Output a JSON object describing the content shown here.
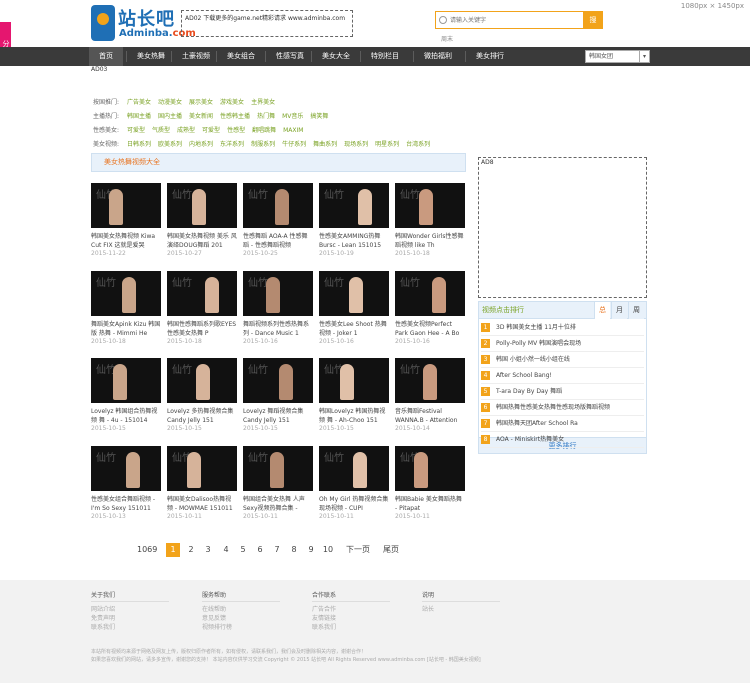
{
  "resolution": "1080px × 1450px",
  "share_label": "分享",
  "logo": {
    "cn": "站长吧",
    "en_main": "Adminba.",
    "en_tail": "com"
  },
  "ad02": "AD02 下载更多的game.net精彩请求 www.adminba.com",
  "search": {
    "placeholder": "请输入关键字",
    "button": "搜",
    "hot": "周末"
  },
  "nav": {
    "items": [
      "首页",
      "美女热舞",
      "土豪视频",
      "美女组合",
      "性感写真",
      "美女大全",
      "特别栏目",
      "微拍福利",
      "美女排行"
    ],
    "active": 0,
    "select_value": "韩国女团"
  },
  "ad03": "AD03",
  "categories": [
    {
      "label": "按国推门:",
      "links": [
        "广告美女",
        "动漫美女",
        "展示美女",
        "游戏美女",
        "主界美女"
      ]
    },
    {
      "label": "主播热门:",
      "links": [
        "韩国主播",
        "国内主播",
        "美女新闻",
        "性感韩主播",
        "热门舞",
        "MV音乐",
        "搞笑舞"
      ]
    },
    {
      "label": "性感美女:",
      "links": [
        "可爱型",
        "气质型",
        "成熟型",
        "可爱型",
        "性感型",
        "翻唱跳舞",
        "MAXIM"
      ]
    },
    {
      "label": "美女视频:",
      "links": [
        "日韩系列",
        "欧美系列",
        "内地系列",
        "东洋系列",
        "制服系列",
        "牛仔系列",
        "舞曲系列",
        "现场系列",
        "明星系列",
        "台湾系列"
      ]
    }
  ],
  "section_title": "美女热舞视频大全",
  "videos": [
    {
      "title": "韩国美女热舞视频 Kiwa Cut FIX 这就是爱哭",
      "date": "2015-11-22"
    },
    {
      "title": "韩国美女热舞视频 美乐 风演绎DOUG舞蹈 201",
      "date": "2015-10-27"
    },
    {
      "title": "性感舞蹈 AOA-A 性感舞蹈 - 性感舞蹈视频",
      "date": "2015-10-25"
    },
    {
      "title": "性感美女AMMING热舞 Bursc - Lean 151015",
      "date": "2015-10-19"
    },
    {
      "title": "韩国Wonder Girls性感舞蹈视频 like Th",
      "date": "2015-10-18"
    },
    {
      "title": "舞蹈美女Apink Kizu 韩国版 热舞 - Mimmi He",
      "date": "2015-10-18"
    },
    {
      "title": "韩国性感舞蹈系列歌EYES 性感美女热舞 P",
      "date": "2015-10-18"
    },
    {
      "title": "舞蹈视频系列性感热舞系列 - Dance Music 1",
      "date": "2015-10-16"
    },
    {
      "title": "性感美女Lee Shoot 热舞视频 - Joker 1",
      "date": "2015-10-16"
    },
    {
      "title": "性感美女视频Perfect Park Gaon Hee - A Bo",
      "date": "2015-10-16"
    },
    {
      "title": "Lovelyz 韩国组合热舞视频 舞 - 4u - 151014",
      "date": "2015-10-15"
    },
    {
      "title": "Lovelyz 多热舞视频合集 Candy Jelly 151",
      "date": "2015-10-15"
    },
    {
      "title": "Lovelyz 舞蹈视频合集 Candy Jelly 151",
      "date": "2015-10-15"
    },
    {
      "title": "韩国Lovelyz 韩国热舞视频 舞 - Ah-Choo 151",
      "date": "2015-10-15"
    },
    {
      "title": "音乐舞蹈Festival WANNA.B - Attention 151",
      "date": "2015-10-14"
    },
    {
      "title": "性感美女组合舞蹈视频 - I'm So Sexy 151011",
      "date": "2015-10-13"
    },
    {
      "title": "韩国美女Dalisoo热舞视频 - MOWMAE 151011",
      "date": "2015-10-11"
    },
    {
      "title": "韩国组合美女热舞 人声 Sexy视频热舞合集 -",
      "date": "2015-10-11"
    },
    {
      "title": "Oh My Girl 热舞视频合集 现场视频 - CUPI",
      "date": "2015-10-11"
    },
    {
      "title": "韩国Babie 美女舞蹈热舞 - Pitapat",
      "date": "2015-10-11"
    }
  ],
  "pager": {
    "total": "1069",
    "pages": [
      "1",
      "2",
      "3",
      "4",
      "5",
      "6",
      "7",
      "8",
      "9",
      "10"
    ],
    "current": 0,
    "next": "下一页",
    "last": "尾页"
  },
  "ad08": "AD8",
  "ranking": {
    "title": "视频点击排行",
    "tabs": [
      "总",
      "月",
      "周"
    ],
    "active_tab": 0,
    "items": [
      "3D 韩国美女主播 11月十位排",
      "Polly-Polly MV 韩国演唱会现场",
      "韩国 小姐小然一线小组在线",
      "After School Bang!",
      "T-ara Day By Day 舞蹈",
      "韩国热舞性感美女热舞性感现场版舞蹈视频",
      "韩国热舞天团After School Ra",
      "AOA - Miniskirt热舞美女"
    ],
    "more": "更多排行"
  },
  "footer": {
    "columns": [
      {
        "title": "关于我们",
        "links": [
          "网站介绍",
          "免责声明",
          "联系我们"
        ]
      },
      {
        "title": "服务帮助",
        "links": [
          "在线帮助",
          "意见反馈",
          "视频排行榜"
        ]
      },
      {
        "title": "合作联系",
        "links": [
          "广告合作",
          "友情链接",
          "联系我们"
        ]
      },
      {
        "title": "说明",
        "links": [
          "站长"
        ]
      }
    ],
    "note1": "本站所有视频均来源于网络及网友上传，版权归原作者所有，如有侵权，请联系我们，我们会及时删除相关内容，谢谢合作！",
    "note2": "如果您喜欢我们的网站，请多多宣传，谢谢您的支持！ 本站内容仅供学习交流  Copyright © 2015 站长吧 All Rights Reserved  www.adminba.com  [站长吧 - 韩国美女视频]"
  },
  "colors": {
    "nav_bg": "#3a3a3a",
    "accent": "#f2a31a",
    "link_green": "#7aa224",
    "section_bg": "#e8f1fa"
  }
}
